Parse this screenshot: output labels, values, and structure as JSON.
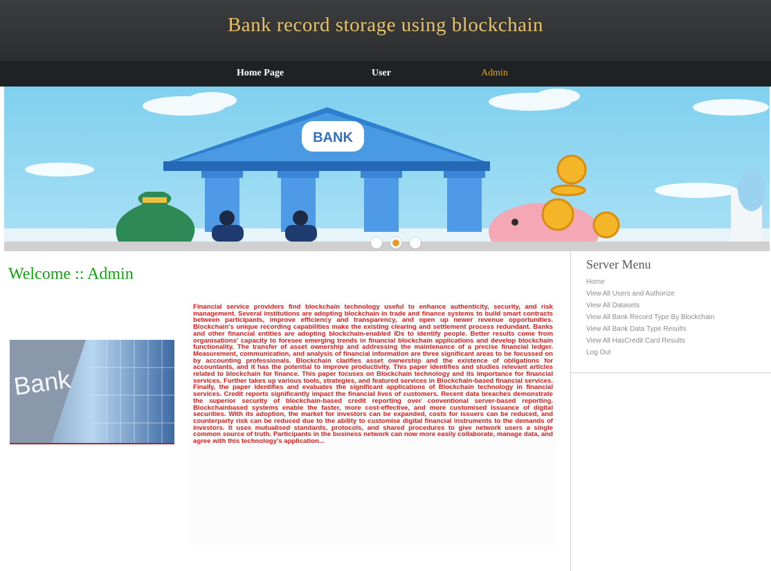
{
  "header": {
    "title": "Bank record storage using blockchain"
  },
  "nav": {
    "items": [
      {
        "label": "Home Page"
      },
      {
        "label": "User"
      },
      {
        "label": "Admin"
      }
    ]
  },
  "banner": {
    "sign": "BANK"
  },
  "welcome": {
    "title": "Welcome :: Admin"
  },
  "photo": {
    "sign": "Bank"
  },
  "article": {
    "text": "Financial service providers find blockchain technology useful to enhance authenticity, security, and risk management. Several institutions are adopting blockchain in trade and finance systems to build smart contracts between participants, improve efficiency and transparency, and open up newer revenue opportunities. Blockchain's unique recording capabilities make the existing clearing and settlement process redundant. Banks and other financial entities are adopting blockchain-enabled IDs to identify people. Better results come from organisations' capacity to foresee emerging trends in financial blockchain applications and develop blockchain functionality. The transfer of asset ownership and addressing the maintenance of a precise financial ledger. Measurement, communication, and analysis of financial information are three significant areas to be focussed on by accounting professionals. Blockchain clarifies asset ownership and the existence of obligations for accountants, and it has the potential to improve productivity. This paper identifies and studies relevant articles related to blockchain for finance. This paper focuses on Blockchain technology and its importance for financial services. Further takes up various tools, strategies, and featured services in Blockchain-based financial services. Finally, the paper identifies and evaluates the significant applications of Blockchain technology in financial services. Credit reports significantly impact the financial lives of customers. Recent data breaches demonstrate the superior security of blockchain-based credit reporting over conventional server-based reporting. Blockchainbased systems enable the faster, more cost-effective, and more customised issuance of digital securities. With its adoption, the market for investors can be expanded, costs for issuers can be reduced, and counterparty risk can be reduced due to the ability to customise digital financial instruments to the demands of investors. It uses mutualised standards, protocols, and shared procedures to give network users a single common source of truth. Participants in the business network can now more easily collaborate, manage data, and agree with this technology's application..."
  },
  "sidebar": {
    "title": "Server Menu",
    "items": [
      {
        "label": "Home"
      },
      {
        "label": "View All Users and Authorize"
      },
      {
        "label": "View All Datasets"
      },
      {
        "label": "View All Bank Record Type By Blockchain"
      },
      {
        "label": "View All Bank Data Type Results"
      },
      {
        "label": "View All HasCredit Card Results"
      },
      {
        "label": "Log Out"
      }
    ]
  },
  "colors": {
    "header_bg": "#2f3133",
    "title": "#e8c26a",
    "nav_active": "#e8a21f",
    "welcome": "#0ea50e",
    "article_text": "#dd1c1c",
    "menu_text": "#8a8a8a"
  }
}
